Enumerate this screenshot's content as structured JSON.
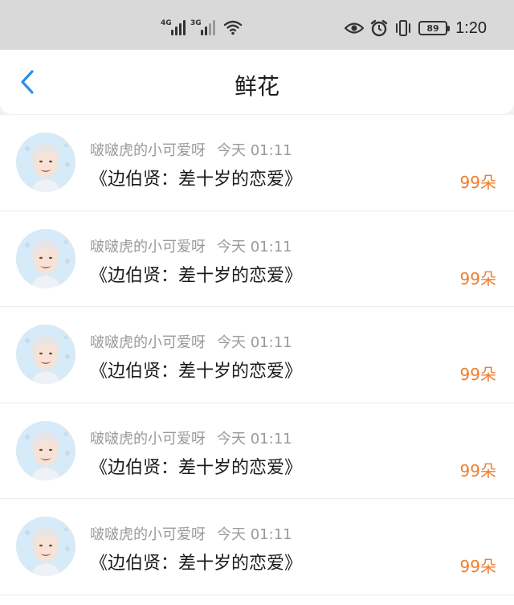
{
  "status_bar": {
    "signal_1_type": "4G",
    "signal_2_type": "3G",
    "battery": "89",
    "time": "1:20",
    "icons": [
      "signal-icon",
      "wifi-icon",
      "eye-icon",
      "alarm-icon",
      "vibrate-icon",
      "battery-icon"
    ]
  },
  "header": {
    "title": "鲜花",
    "back_icon": "chevron-left-icon"
  },
  "colors": {
    "accent_blue": "#2d8cf0",
    "count_orange": "#f07d2a",
    "meta_gray": "#9a9a9a"
  },
  "items": [
    {
      "user": "啵啵虎的小可爱呀",
      "time": "今天 01:11",
      "title": "《边伯贤：差十岁的恋爱》",
      "count": "99朵"
    },
    {
      "user": "啵啵虎的小可爱呀",
      "time": "今天 01:11",
      "title": "《边伯贤：差十岁的恋爱》",
      "count": "99朵"
    },
    {
      "user": "啵啵虎的小可爱呀",
      "time": "今天 01:11",
      "title": "《边伯贤：差十岁的恋爱》",
      "count": "99朵"
    },
    {
      "user": "啵啵虎的小可爱呀",
      "time": "今天 01:11",
      "title": "《边伯贤：差十岁的恋爱》",
      "count": "99朵"
    },
    {
      "user": "啵啵虎的小可爱呀",
      "time": "今天 01:11",
      "title": "《边伯贤：差十岁的恋爱》",
      "count": "99朵"
    }
  ]
}
